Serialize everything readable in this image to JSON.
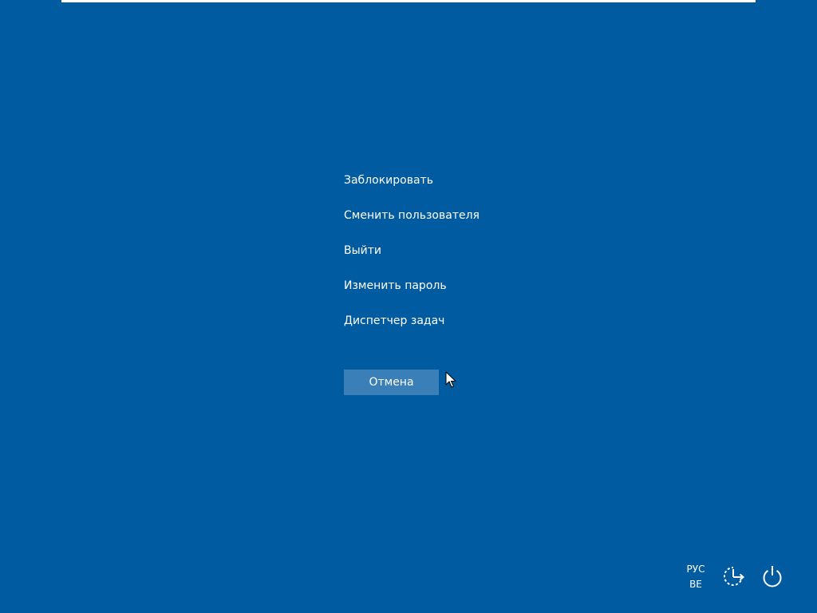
{
  "menu": {
    "items": [
      {
        "label": "Заблокировать"
      },
      {
        "label": "Сменить пользователя"
      },
      {
        "label": "Выйти"
      },
      {
        "label": "Изменить пароль"
      },
      {
        "label": "Диспетчер задач"
      }
    ]
  },
  "cancel": {
    "label": "Отмена"
  },
  "language": {
    "line1": "РУС",
    "line2": "BE"
  },
  "icons": {
    "ease_of_access": "ease-of-access-icon",
    "power": "power-icon",
    "cursor": "mouse-cursor-icon"
  },
  "colors": {
    "background": "#015ba1",
    "button": "#3a7fb7",
    "text": "#ffffff"
  }
}
